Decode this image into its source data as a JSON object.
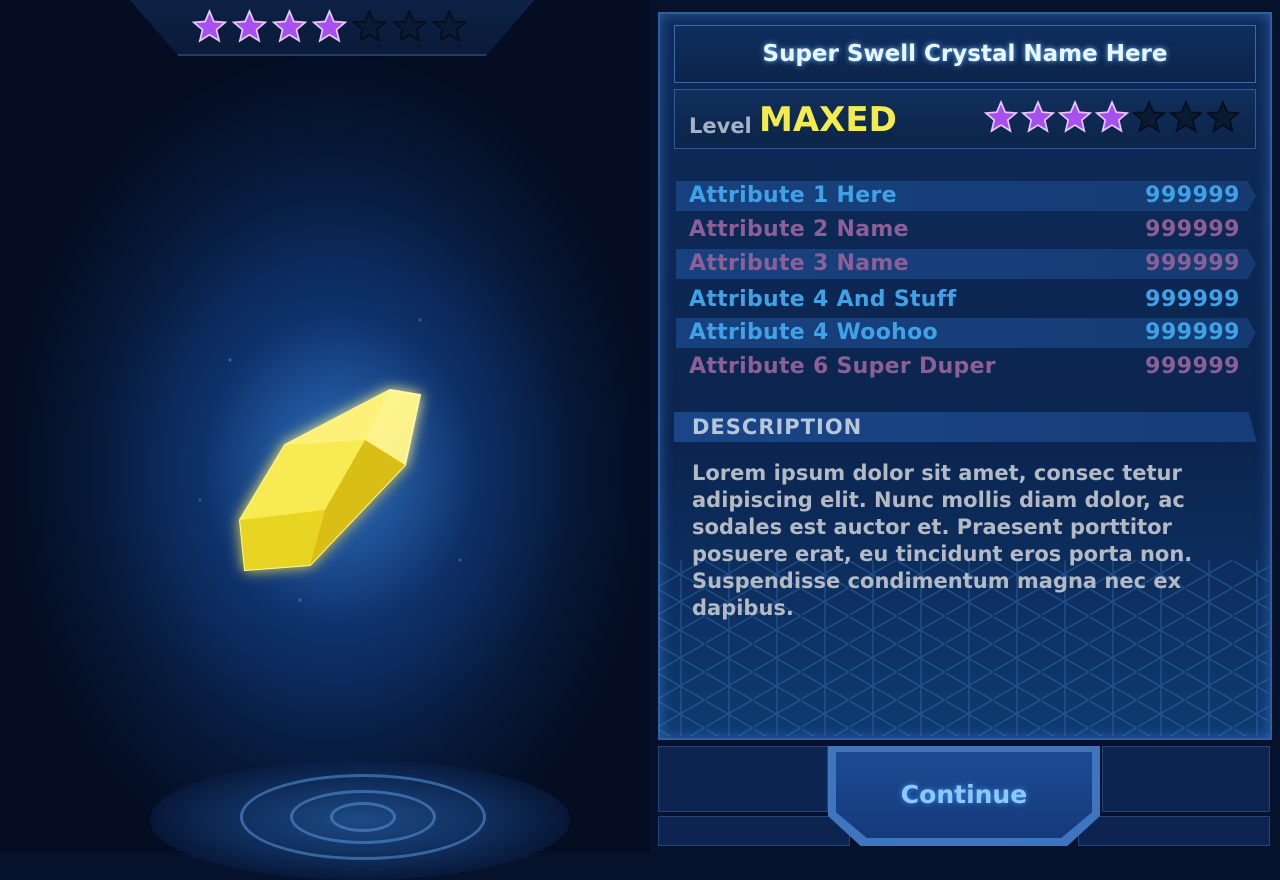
{
  "item": {
    "title": "Super Swell Crystal Name Here",
    "rating_filled": 4,
    "rating_total": 7
  },
  "level": {
    "label": "Level",
    "value": "MAXED"
  },
  "attributes": [
    {
      "name": "Attribute 1 Here",
      "value": "999999"
    },
    {
      "name": "Attribute 2 Name",
      "value": "999999"
    },
    {
      "name": "Attribute 3 Name",
      "value": "999999"
    },
    {
      "name": "Attribute 4 And Stuff",
      "value": "999999"
    },
    {
      "name": "Attribute 4 Woohoo",
      "value": "999999"
    },
    {
      "name": "Attribute 6 Super Duper",
      "value": "999999"
    }
  ],
  "description": {
    "header": "DESCRIPTION",
    "lines": [
      "Lorem ipsum dolor sit amet, consec tetur",
      "adipiscing elit. Nunc mollis diam dolor, ac",
      "sodales est auctor et. Praesent porttitor",
      "posuere erat, eu tincidunt eros porta non.",
      "Suspendisse condimentum magna nec ex",
      "dapibus."
    ]
  },
  "actions": {
    "continue_label": "Continue"
  },
  "colors": {
    "star_filled": "#a84ff0",
    "star_empty": "#0b1a33",
    "level_value": "#f3ec4c",
    "attr_blue": "#3fa2e6",
    "attr_purple": "#8c5f96",
    "crystal": "#f2e21c"
  },
  "icons": {
    "star": "star-icon",
    "crystal": "crystal-icon"
  }
}
